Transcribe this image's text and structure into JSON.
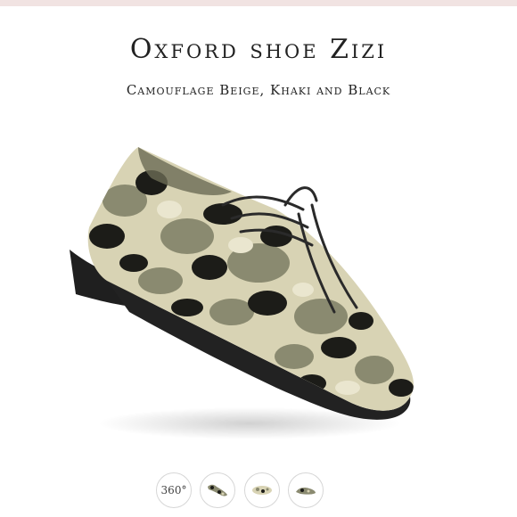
{
  "product": {
    "title": "Oxford shoe Zizi",
    "subtitle": "Camouflage Beige, Khaki and Black"
  },
  "views": {
    "rotate_label": "360°",
    "items": [
      "360-view",
      "side-view",
      "top-view",
      "sole-view"
    ]
  },
  "colors": {
    "accent_strip": "#f1e3e2",
    "camo_beige": "#d8d3b4",
    "camo_khaki": "#8a8a70",
    "camo_black": "#1c1c18"
  }
}
